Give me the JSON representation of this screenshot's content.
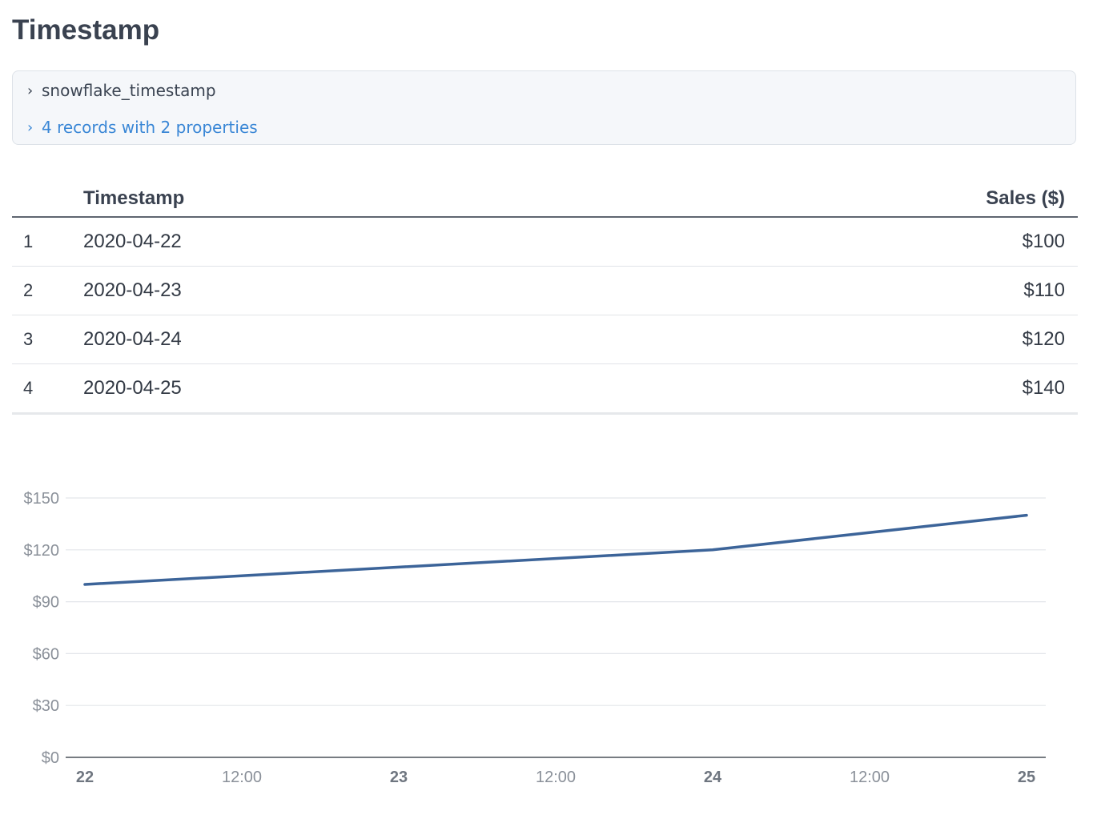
{
  "title": "Timestamp",
  "info": {
    "source": "snowflake_timestamp",
    "records": "4 records with 2 properties"
  },
  "table": {
    "headers": [
      "Timestamp",
      "Sales ($)"
    ],
    "rows": [
      {
        "index": "1",
        "timestamp": "2020-04-22",
        "sales": "$100"
      },
      {
        "index": "2",
        "timestamp": "2020-04-23",
        "sales": "$110"
      },
      {
        "index": "3",
        "timestamp": "2020-04-24",
        "sales": "$120"
      },
      {
        "index": "4",
        "timestamp": "2020-04-25",
        "sales": "$140"
      }
    ]
  },
  "chart_data": {
    "type": "line",
    "x": [
      "2020-04-22",
      "2020-04-23",
      "2020-04-24",
      "2020-04-25"
    ],
    "series": [
      {
        "values": [
          100,
          110,
          120,
          140
        ],
        "color": "#3c6499"
      }
    ],
    "ylim": [
      0,
      150
    ],
    "yticks": [
      0,
      30,
      60,
      90,
      120,
      150
    ],
    "ytick_labels": [
      "$0",
      "$30",
      "$60",
      "$90",
      "$120",
      "$150"
    ],
    "xticks": [
      {
        "at": "2020-04-22T00:00",
        "label": "22",
        "major": true
      },
      {
        "at": "2020-04-22T12:00",
        "label": "12:00",
        "major": false
      },
      {
        "at": "2020-04-23T00:00",
        "label": "23",
        "major": true
      },
      {
        "at": "2020-04-23T12:00",
        "label": "12:00",
        "major": false
      },
      {
        "at": "2020-04-24T00:00",
        "label": "24",
        "major": true
      },
      {
        "at": "2020-04-24T12:00",
        "label": "12:00",
        "major": false
      },
      {
        "at": "2020-04-25T00:00",
        "label": "25",
        "major": true
      }
    ],
    "grid": true,
    "title": "",
    "xlabel": "",
    "ylabel": ""
  }
}
